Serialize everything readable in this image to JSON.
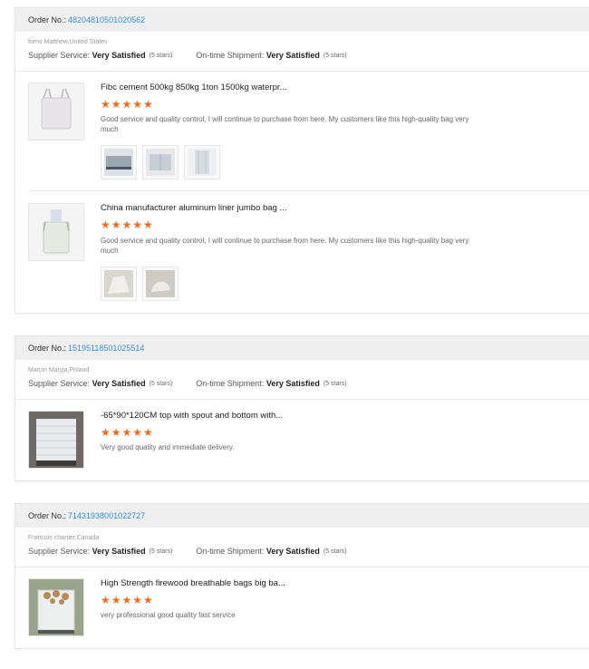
{
  "orders": [
    {
      "order_label": "Order No.:",
      "order_number": "48204810501020562",
      "buyer": "forns Matthew,United States",
      "supplier_service_label": "Supplier Service:",
      "supplier_service_value": "Very Satisfied",
      "supplier_service_stars": "(5 stars)",
      "shipment_label": "On-time Shipment:",
      "shipment_value": "Very Satisfied",
      "shipment_stars": "(5 stars)",
      "items": [
        {
          "title": "Fibc cement 500kg 850kg 1ton 1500kg waterpr...",
          "stars": "★★★★★",
          "rating": 5,
          "comment": "Good service and quality control, I will continue to purchase from here. My customers like this high-quality bag very much",
          "photo_count": 3
        },
        {
          "title": "China manufacturer aluminum liner jumbo bag ...",
          "stars": "★★★★★",
          "rating": 5,
          "comment": "Good service and quality control, I will continue to purchase from here. My customers like this high-quality bag very much",
          "photo_count": 2
        }
      ]
    },
    {
      "order_label": "Order No.:",
      "order_number": "15195118501025514",
      "buyer": "Marcin Matyja,Poland",
      "supplier_service_label": "Supplier Service:",
      "supplier_service_value": "Very Satisfied",
      "supplier_service_stars": "(5 stars)",
      "shipment_label": "On-time Shipment:",
      "shipment_value": "Very Satisfied",
      "shipment_stars": "(5 stars)",
      "items": [
        {
          "title": "-65*90*120CM top with spout and bottom with...",
          "stars": "★★★★★",
          "rating": 5,
          "comment": "Very good quality and immediate delivery."
        }
      ]
    },
    {
      "order_label": "Order No.:",
      "order_number": "71431938001022727",
      "buyer": "Francois chartier,Canada",
      "supplier_service_label": "Supplier Service:",
      "supplier_service_value": "Very Satisfied",
      "supplier_service_stars": "(5 stars)",
      "shipment_label": "On-time Shipment:",
      "shipment_value": "Very Satisfied",
      "shipment_stars": "(5 stars)",
      "items": [
        {
          "title": "High Strength firewood breathable bags big ba...",
          "stars": "★★★★★",
          "rating": 5,
          "comment": "very professional good quality fast service"
        }
      ]
    }
  ],
  "colors": {
    "accent_link": "#3a8fd6",
    "star": "#f06b1e",
    "header_bg": "#efefef"
  }
}
